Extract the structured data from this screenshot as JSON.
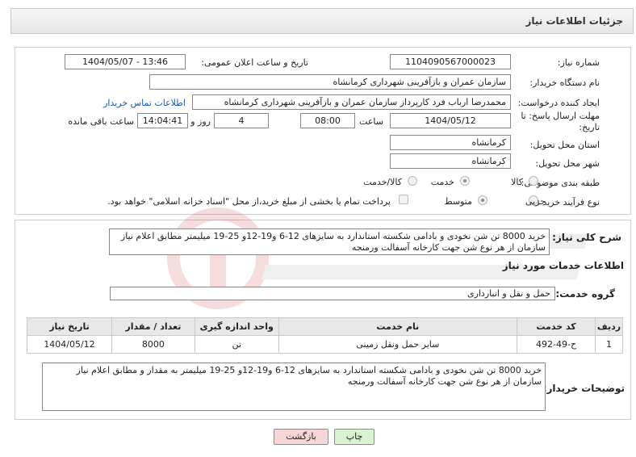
{
  "header": {
    "title": "جزئیات اطلاعات نیاز"
  },
  "need_info": {
    "need_number_label": "شماره نیاز:",
    "need_number": "1104090567000023",
    "announce_label": "تاریخ و ساعت اعلان عمومی:",
    "announce_value": "1404/05/07 - 13:46",
    "buyer_label": "نام دستگاه خریدار:",
    "buyer_value": "سازمان عمران و بازآفرینی شهرداری کرمانشاه",
    "creator_label": "ایجاد کننده درخواست:",
    "creator_value": "محمدرضا ارباب فرد کارپرداز سازمان عمران و بازآفرینی شهرداری کرمانشاه",
    "contact_link": "اطلاعات تماس خریدار",
    "deadline_label_1": "مهلت ارسال پاسخ: تا",
    "deadline_label_2": "تاریخ:",
    "deadline_date": "1404/05/12",
    "hour_label": "ساعت",
    "deadline_hour": "08:00",
    "days": "4",
    "days_label": "روز و",
    "remaining_time": "14:04:41",
    "remaining_label": "ساعت باقی مانده",
    "province_label": "استان محل تحویل:",
    "province_value": "کرمانشاه",
    "city_label": "شهر محل تحویل:",
    "city_value": "کرمانشاه",
    "category_label": "طبقه بندی موضوعی:",
    "category_options": [
      "کالا",
      "خدمت",
      "کالا/خدمت"
    ],
    "purchase_type_label": "نوع فرآیند خرید :",
    "purchase_options": [
      "جزیی",
      "متوسط"
    ],
    "payment_note": "پرداخت تمام یا بخشی از مبلغ خرید،از محل \"اسناد خزانه اسلامی\" خواهد بود."
  },
  "summary": {
    "label": "شرح کلی نیاز:",
    "text": "خرید 8000 تن شن نخودی و بادامی شکسته استاندارد به سایزهای 12-6 و19-12و 25-19 میلیمتر مطابق اعلام نیاز سازمان از هر نوع شن جهت کارخانه آسفالت ورمنجه"
  },
  "services": {
    "section_title": "اطلاعات خدمات مورد نیاز",
    "group_label": "گروه خدمت:",
    "group_value": "حمل و نقل و انبارداری",
    "columns": [
      "ردیف",
      "کد خدمت",
      "نام خدمت",
      "واحد اندازه گیری",
      "تعداد / مقدار",
      "تاریخ نیاز"
    ],
    "rows": [
      [
        "1",
        "ح-49-492",
        "سایر حمل ونقل زمینی",
        "تن",
        "8000",
        "1404/05/12"
      ]
    ]
  },
  "buyer_notes": {
    "label": "توضیحات خریدار:",
    "text": "خرید 8000 تن شن نخودی و بادامی شکسته استاندارد به سایزهای 12-6 و19-12و 25-19 میلیمتر به مقدار و مطابق اعلام نیاز سازمان از هر نوع شن جهت کارخانه آسفالت ورمنجه"
  },
  "buttons": {
    "print": "چاپ",
    "back": "بازگشت"
  },
  "colors": {
    "print_bg": "#d9f2cf",
    "back_bg": "#f6d6d6",
    "link": "#1a55c0"
  }
}
